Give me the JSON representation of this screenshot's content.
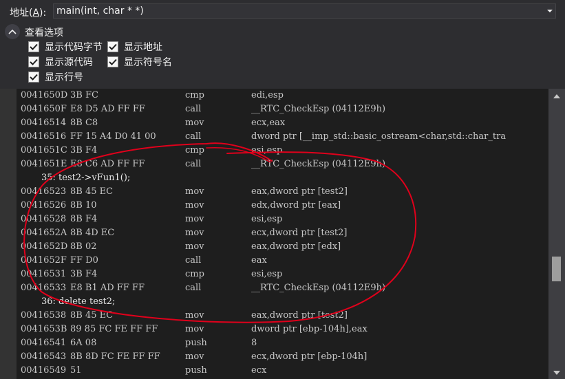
{
  "address": {
    "label": "地址(",
    "label_key": "A",
    "label_end": "):",
    "value": "main(int, char * *)"
  },
  "options": {
    "title": "查看选项",
    "checkboxes": [
      {
        "label": "显示代码字节",
        "checked": true
      },
      {
        "label": "显示地址",
        "checked": true
      },
      {
        "label": "显示源代码",
        "checked": true
      },
      {
        "label": "显示符号名",
        "checked": true
      },
      {
        "label": "显示行号",
        "checked": true
      }
    ]
  },
  "disassembly": {
    "rows": [
      {
        "type": "asm",
        "addr": "0041650D",
        "bytes": "3B FC",
        "op": "cmp",
        "args": "edi,esp"
      },
      {
        "type": "asm",
        "addr": "0041650F",
        "bytes": "E8 D5 AD FF FF",
        "op": "call",
        "args": "__RTC_CheckEsp (04112E9h)"
      },
      {
        "type": "asm",
        "addr": "00416514",
        "bytes": "8B C8",
        "op": "mov",
        "args": "ecx,eax"
      },
      {
        "type": "asm",
        "addr": "00416516",
        "bytes": "FF 15 A4 D0 41 00",
        "op": "call",
        "args": "dword ptr [__imp_std::basic_ostream<char,std::char_tra"
      },
      {
        "type": "asm",
        "addr": "0041651C",
        "bytes": "3B F4",
        "op": "cmp",
        "args": "esi,esp"
      },
      {
        "type": "asm",
        "addr": "0041651E",
        "bytes": "E8 C6 AD FF FF",
        "op": "call",
        "args": "__RTC_CheckEsp (04112E9h)"
      },
      {
        "type": "src",
        "text": "35:     test2->vFun1();"
      },
      {
        "type": "asm",
        "addr": "00416523",
        "bytes": "8B 45 EC",
        "op": "mov",
        "args": "eax,dword ptr [test2]"
      },
      {
        "type": "asm",
        "addr": "00416526",
        "bytes": "8B 10",
        "op": "mov",
        "args": "edx,dword ptr [eax]"
      },
      {
        "type": "asm",
        "addr": "00416528",
        "bytes": "8B F4",
        "op": "mov",
        "args": "esi,esp"
      },
      {
        "type": "asm",
        "addr": "0041652A",
        "bytes": "8B 4D EC",
        "op": "mov",
        "args": "ecx,dword ptr [test2]"
      },
      {
        "type": "asm",
        "addr": "0041652D",
        "bytes": "8B 02",
        "op": "mov",
        "args": "eax,dword ptr [edx]"
      },
      {
        "type": "asm",
        "addr": "0041652F",
        "bytes": "FF D0",
        "op": "call",
        "args": "eax"
      },
      {
        "type": "asm",
        "addr": "00416531",
        "bytes": "3B F4",
        "op": "cmp",
        "args": "esi,esp"
      },
      {
        "type": "asm",
        "addr": "00416533",
        "bytes": "E8 B1 AD FF FF",
        "op": "call",
        "args": "__RTC_CheckEsp (04112E9h)"
      },
      {
        "type": "src",
        "text": "36:     delete test2;"
      },
      {
        "type": "asm",
        "addr": "00416538",
        "bytes": "8B 45 EC",
        "op": "mov",
        "args": "eax,dword ptr [test2]"
      },
      {
        "type": "asm",
        "addr": "0041653B",
        "bytes": "89 85 FC FE FF FF",
        "op": "mov",
        "args": "dword ptr [ebp-104h],eax"
      },
      {
        "type": "asm",
        "addr": "00416541",
        "bytes": "6A 08",
        "op": "push",
        "args": "8"
      },
      {
        "type": "asm",
        "addr": "00416543",
        "bytes": "8B 8D FC FE FF FF",
        "op": "mov",
        "args": "ecx,dword ptr [ebp-104h]"
      },
      {
        "type": "asm",
        "addr": "00416549",
        "bytes": "51",
        "op": "push",
        "args": "ecx"
      }
    ]
  },
  "colors": {
    "background": "#2d2d30",
    "code_background": "#1e1e1e",
    "code_text": "#c8c8c8",
    "annotation_red": "#e0001b",
    "scrollbar_thumb": "#9e9e9e"
  },
  "icons": {
    "options_toggle": "chevron-up-icon",
    "address_dropdown": "triangle-down-icon",
    "checkbox_mark": "check-icon",
    "scroll_up": "arrow-up-icon",
    "scroll_down": "arrow-down-icon"
  }
}
